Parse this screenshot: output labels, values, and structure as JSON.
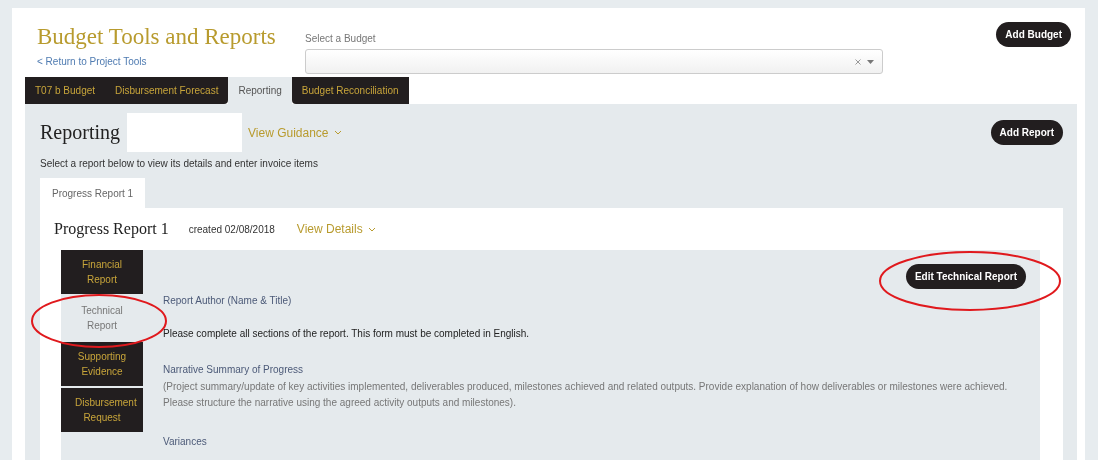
{
  "header": {
    "title": "Budget Tools and Reports",
    "back_link": "< Return to Project Tools",
    "select_label": "Select a Budget",
    "add_button": "Add Budget"
  },
  "tabs": [
    {
      "label": "T07 b Budget",
      "selected": false
    },
    {
      "label": "Disbursement Forecast",
      "selected": false
    },
    {
      "label": "Reporting",
      "selected": true
    },
    {
      "label": "Budget Reconciliation",
      "selected": false
    }
  ],
  "reporting": {
    "title": "Reporting",
    "guidance": "View Guidance",
    "add_button": "Add Report",
    "hint": "Select a report below to view its details and enter invoice items",
    "report_tabs": [
      {
        "label": "Progress Report 1",
        "selected": true
      }
    ],
    "report": {
      "title": "Progress Report 1",
      "created": "created 02/08/2018",
      "details": "View Details",
      "sections": [
        {
          "label": "Financial Report",
          "selected": false
        },
        {
          "label": "Technical Report",
          "selected": true
        },
        {
          "label": "Supporting Evidence",
          "selected": false
        },
        {
          "label": "Disbursement Request",
          "selected": false
        }
      ],
      "edit_button": "Edit Technical Report",
      "author_label": "Report Author (Name & Title)",
      "instruction": "Please complete all sections of the report. This form must be completed in English.",
      "fields": [
        {
          "heading": "Narrative Summary of Progress",
          "help": "(Project summary/update of key activities implemented, deliverables produced, milestones achieved and related outputs. Provide explanation of how deliverables or milestones were achieved. Please structure the narrative using the agreed activity outputs and milestones)."
        },
        {
          "heading": "Variances"
        }
      ]
    }
  }
}
